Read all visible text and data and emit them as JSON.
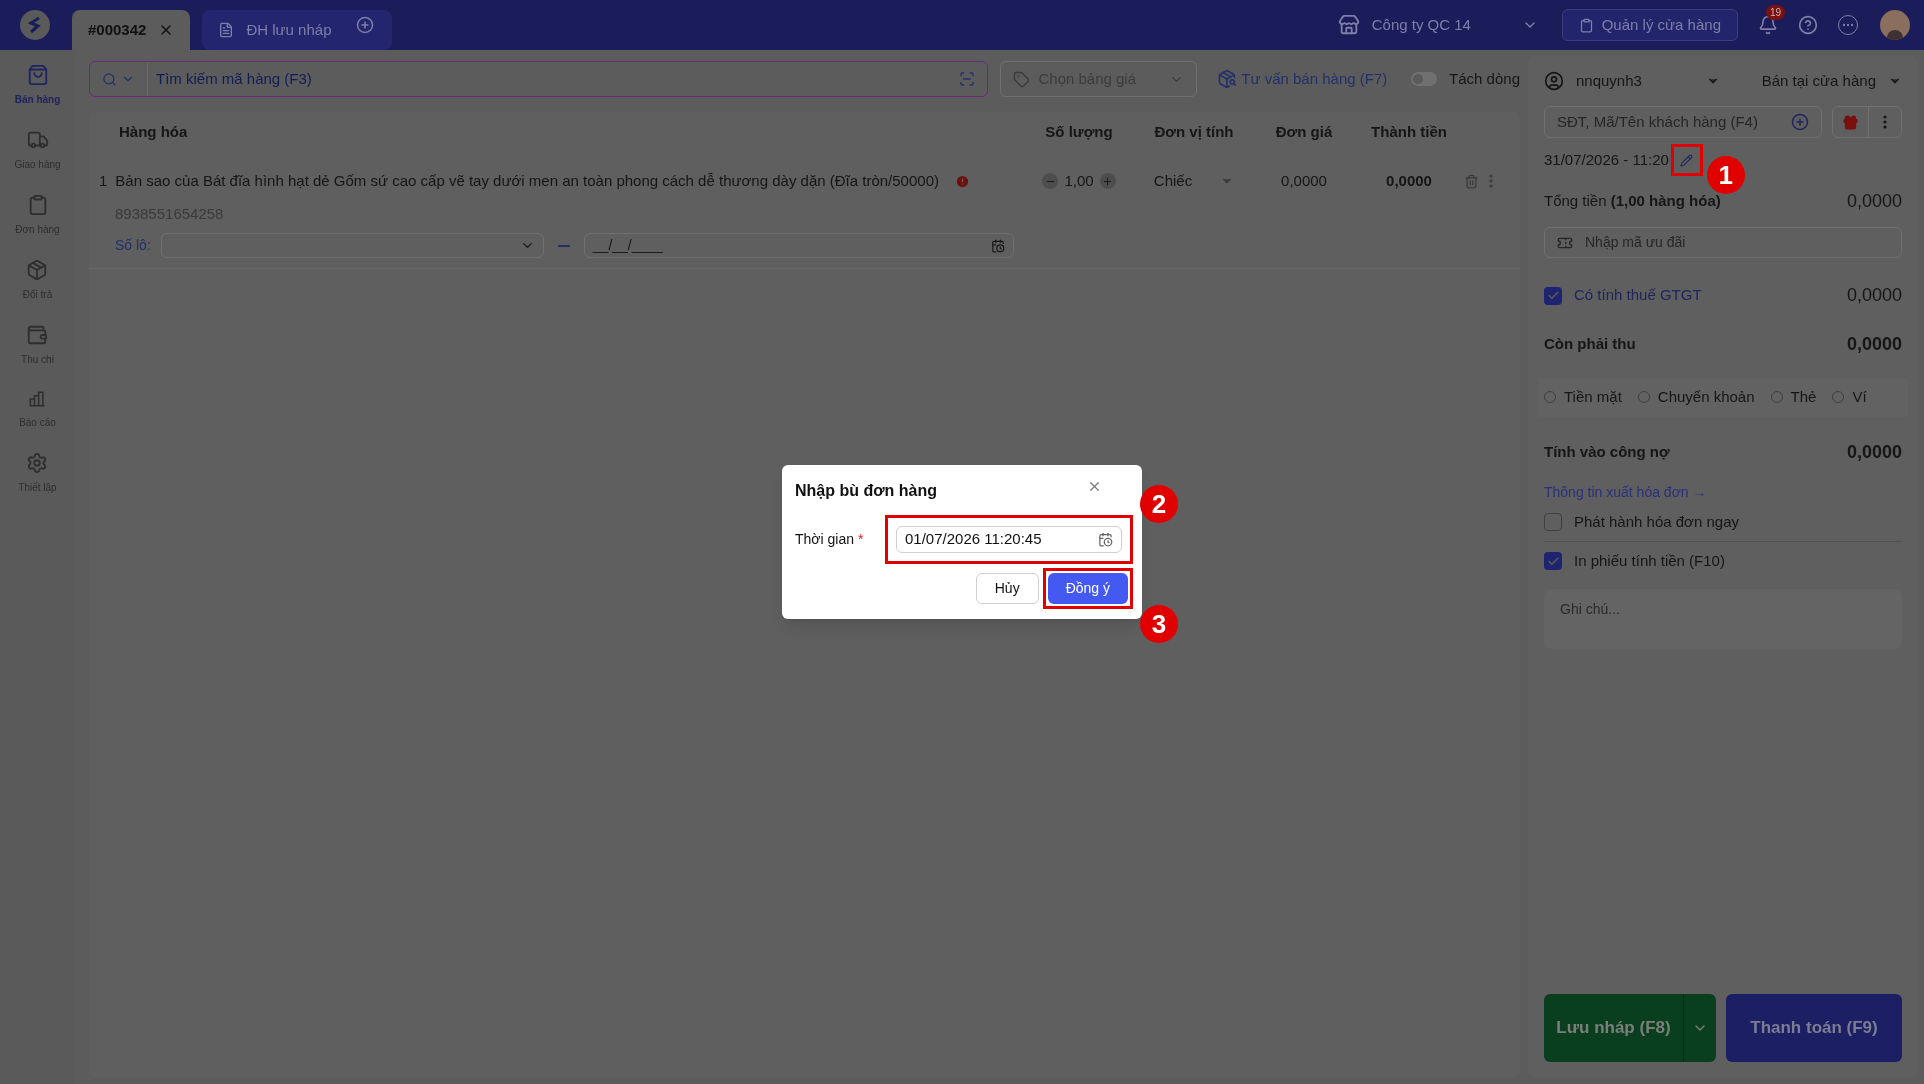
{
  "top_bar": {
    "tabs": [
      {
        "label": "#000342",
        "selected": true,
        "closable": true
      },
      {
        "label": "ĐH lưu nháp",
        "selected": false,
        "closable": false
      }
    ],
    "company": "Công ty QC 14",
    "store_button": "Quản lý cửa hàng",
    "notification_count": "19"
  },
  "sidebar": {
    "items": [
      {
        "label": "Bán hàng",
        "selected": true
      },
      {
        "label": "Giao hàng",
        "selected": false
      },
      {
        "label": "Đơn hàng",
        "selected": false
      },
      {
        "label": "Đổi trả",
        "selected": false
      },
      {
        "label": "Thu chi",
        "selected": false
      },
      {
        "label": "Báo cáo",
        "selected": false
      },
      {
        "label": "Thiết lập",
        "selected": false
      }
    ]
  },
  "toolbar": {
    "search_placeholder": "Tìm kiếm mã hàng (F3)",
    "price_list_placeholder": "Chọn bảng giá",
    "advice_link": "Tư vấn bán hàng (F7)",
    "split_toggle": {
      "label": "Tách dòng",
      "on": false
    }
  },
  "table": {
    "columns": [
      "Hàng hóa",
      "Số lượng",
      "Đơn vị tính",
      "Đơn giá",
      "Thành tiền"
    ],
    "rows": [
      {
        "index": "1",
        "name": "Bản sao của Bát đĩa hình hạt dẻ Gốm sứ cao cấp vẽ tay dưới men an toàn phong cách dễ thương dày dặn (Đĩa tròn/50000)",
        "barcode": "8938551654258",
        "quantity": "1,00",
        "unit": "Chiếc",
        "price": "0,0000",
        "total": "0,0000",
        "lot_label": "Số lô:",
        "date_placeholder": "__/__/____"
      }
    ]
  },
  "order_panel": {
    "staff": "nnquynh3",
    "channel": "Bán tại cửa hàng",
    "customer_placeholder": "SĐT, Mã/Tên khách hàng (F4)",
    "order_time": "31/07/2026 - 11:20",
    "total_label": "Tổng tiền **(1,00 hàng hóa)**",
    "total_value": "0,0000",
    "promo_placeholder": "Nhập mã ưu đãi",
    "vat": {
      "label": "Có tính thuế GTGT",
      "checked": true,
      "value": "0,0000"
    },
    "due": {
      "label": "Còn phải thu",
      "value": "0,0000"
    },
    "payment_methods": [
      {
        "label": "Tiền mặt",
        "selected": false
      },
      {
        "label": "Chuyển khoản",
        "selected": false
      },
      {
        "label": "Thẻ",
        "selected": false
      },
      {
        "label": "Ví",
        "selected": false
      }
    ],
    "debt": {
      "label": "Tính vào công nợ",
      "value": "0,0000"
    },
    "invoice_link": "Thông tin xuất hóa đơn →",
    "options": [
      {
        "label": "Phát hành hóa đơn ngay",
        "checked": false
      },
      {
        "label": "In phiếu tính tiền (F10)",
        "checked": true
      }
    ],
    "note_placeholder": "Ghi chú...",
    "save_draft": "Lưu nháp (F8)",
    "checkout": "Thanh toán (F9)"
  },
  "dialog": {
    "title": "Nhập bù đơn hàng",
    "field_label": "Thời gian",
    "required_mark": "*",
    "field_value": "01/07/2026 11:20:45",
    "cancel": "Hủy",
    "confirm": "Đồng ý"
  },
  "annotations": [
    "1",
    "2",
    "3"
  ]
}
